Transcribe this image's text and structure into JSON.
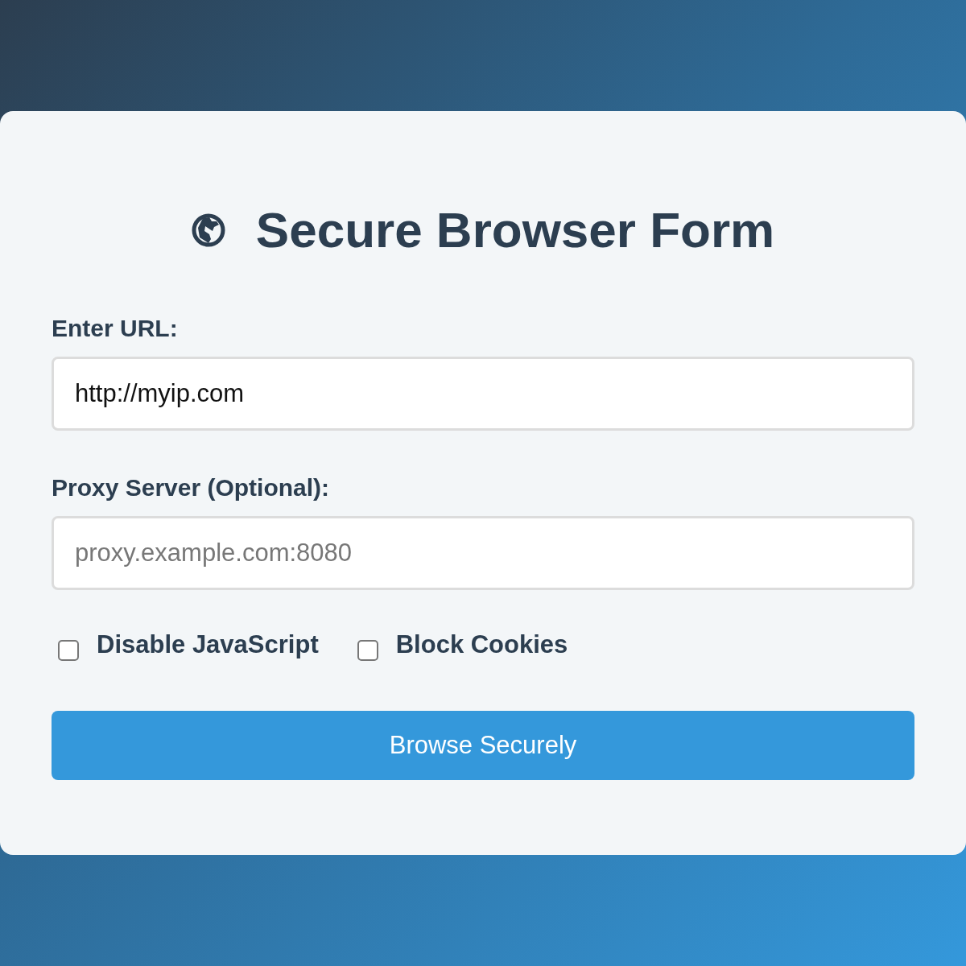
{
  "title": "Secure Browser Form",
  "fields": [
    {
      "label": "Enter URL:",
      "value": "http://myip.com"
    },
    {
      "label": "Proxy Server (Optional):",
      "placeholder": "proxy.example.com:8080"
    }
  ],
  "options": [
    {
      "label": "Disable JavaScript",
      "checked": false
    },
    {
      "label": "Block Cookies",
      "checked": false
    }
  ],
  "submit": "Browse Securely"
}
